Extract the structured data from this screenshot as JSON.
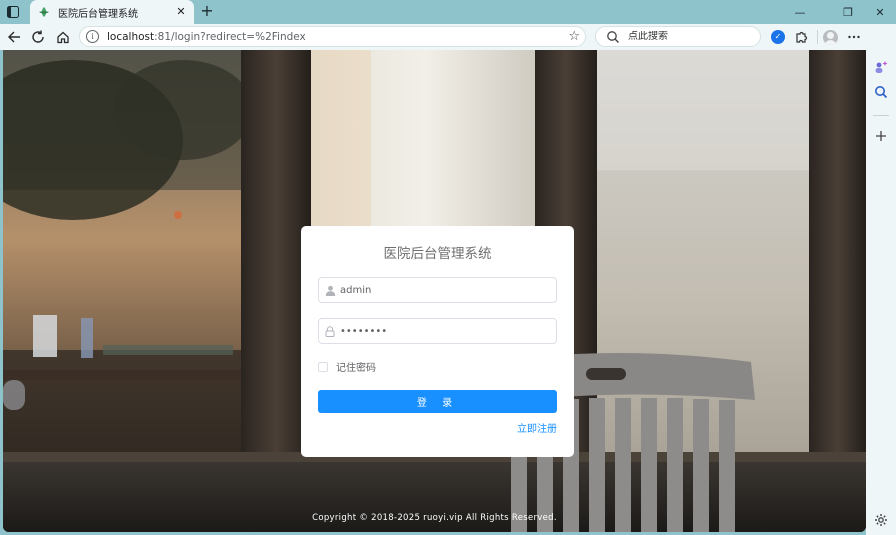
{
  "browser": {
    "tab": {
      "title": "医院后台管理系统",
      "close": "✕"
    },
    "new_tab": "+",
    "window": {
      "minimize": "—",
      "restore": "❐",
      "close": "✕"
    },
    "address": {
      "host": "localhost",
      "rest": ":81/login?redirect=%2Findex"
    },
    "search": {
      "placeholder": "点此搜索"
    },
    "extension_badge": "✓"
  },
  "login": {
    "title": "医院后台管理系统",
    "username": "admin",
    "password": "admin123",
    "remember_label": "记住密码",
    "login_button": "登 录",
    "register_link": "立即注册"
  },
  "footer": {
    "copyright": "Copyright © 2018-2025 ruoyi.vip All Rights Reserved."
  },
  "colors": {
    "primary": "#1890ff",
    "browser_frame": "#8fc3cb",
    "browser_toolbar": "#eef6f7"
  }
}
